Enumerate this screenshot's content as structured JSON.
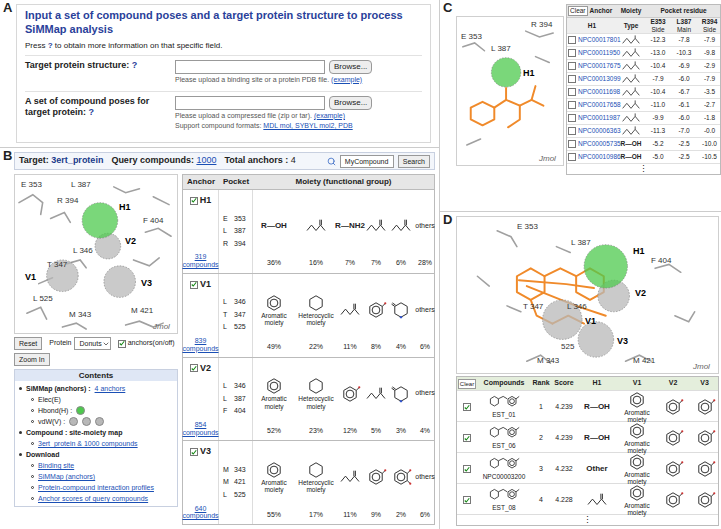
{
  "panel_letters": [
    "A",
    "B",
    "C",
    "D"
  ],
  "form": {
    "title": "Input a set of compound poses and a target protein structure to process SiMMap analysis",
    "help_prefix": "Press",
    "help_icon": "?",
    "help_suffix": "to obtain more information on that specific field.",
    "fields": [
      {
        "label": "Target protein structure:",
        "help": "?",
        "button": "Browse...",
        "hint": "Please upload a binding site or a protein PDB file.",
        "example": "(example)"
      },
      {
        "label": "A set of compound poses for target protein:",
        "help": "?",
        "button": "Browse...",
        "hint": "Please upload a compressed file (zip or tar).",
        "example": "(example)"
      }
    ],
    "formats_label": "Support compound formats:",
    "formats": "MDL mol, SYBYL mol2, PDB"
  },
  "summary": {
    "target_label": "Target:",
    "target": "3ert_protein",
    "query_label": "Query compounds:",
    "query": "1000",
    "total_label": "Total anchors :",
    "total": "4"
  },
  "search": {
    "value": "MyCompound",
    "button": "Search"
  },
  "viewer_b": {
    "residues": [
      "E 353",
      "L 387",
      "R 394",
      "F 404",
      "L 346",
      "T 347",
      "L 525",
      "M 343",
      "M 421"
    ],
    "anchors": [
      {
        "label": "H1",
        "color": "#4ec94e"
      },
      {
        "label": "V2",
        "color": "#b8b8b8"
      },
      {
        "label": "V1",
        "color": "#b8b8b8"
      },
      {
        "label": "V3",
        "color": "#b8b8b8"
      }
    ],
    "brand": "Jmol"
  },
  "controls": {
    "reset": "Reset",
    "protein_label": "Protein",
    "protein_value": "Donuts",
    "anchors_toggle": {
      "label": "anchors(on/off)",
      "checked": true
    },
    "zoom": "Zoom In"
  },
  "contents": {
    "title": "Contents",
    "items": [
      {
        "text": "SiMMap (anchors) :",
        "link": "4 anchors",
        "children": [
          {
            "text": "Elec(E)",
            "spheres": []
          },
          {
            "text": "Hbond(H) :",
            "spheres": [
              "#4ec94e"
            ]
          },
          {
            "text": "vdW(V) :",
            "spheres": [
              "#b8b8b8",
              "#b8b8b8",
              "#b8b8b8"
            ]
          }
        ]
      },
      {
        "text": "Compound : site-moiety map",
        "link": "",
        "children": [
          {
            "link": "3ert_protein & 1000 compounds"
          }
        ]
      },
      {
        "text": "Download",
        "link": "",
        "children": [
          {
            "link": "Binding site"
          },
          {
            "link": "SiMMap (anchors)"
          },
          {
            "link": "Protein-compound interaction profiles"
          },
          {
            "link": "Anchor scores of query compounds"
          }
        ]
      }
    ]
  },
  "anchor_table": {
    "columns": [
      "Anchor",
      "Pocket",
      "Moiety (functional group)"
    ],
    "rows": [
      {
        "anchor": "H1",
        "checked": true,
        "compounds": "319 compounds",
        "pocket": [
          {
            "aa": "E",
            "num": "353"
          },
          {
            "aa": "L",
            "num": "387"
          },
          {
            "aa": "R",
            "num": "394"
          }
        ],
        "moieties": [
          {
            "kind": "formula",
            "label": "R—OH",
            "pct": "36%"
          },
          {
            "kind": "chain",
            "pct": "16%"
          },
          {
            "kind": "formula",
            "label": "R—NH2",
            "pct": "7%"
          },
          {
            "kind": "chain",
            "pct": "7%"
          },
          {
            "kind": "chain",
            "pct": "6%"
          },
          {
            "kind": "others",
            "label": "others",
            "pct": "28%"
          }
        ]
      },
      {
        "anchor": "V1",
        "checked": true,
        "compounds": "839 compounds",
        "pocket": [
          {
            "aa": "L",
            "num": "346"
          },
          {
            "aa": "T",
            "num": "347"
          },
          {
            "aa": "L",
            "num": "525"
          }
        ],
        "moieties": [
          {
            "kind": "benzene",
            "label": "Aromatic moiety",
            "pct": "49%"
          },
          {
            "kind": "cyclohexane",
            "label": "Heterocyclic moiety",
            "pct": "22%"
          },
          {
            "kind": "chain",
            "pct": "11%"
          },
          {
            "kind": "phenol",
            "pct": "8%"
          },
          {
            "kind": "pyridone",
            "pct": "4%"
          },
          {
            "kind": "others",
            "label": "others",
            "pct": "6%"
          }
        ]
      },
      {
        "anchor": "V2",
        "checked": true,
        "compounds": "854 compounds",
        "pocket": [
          {
            "aa": "L",
            "num": "346"
          },
          {
            "aa": "L",
            "num": "387"
          },
          {
            "aa": "F",
            "num": "404"
          }
        ],
        "moieties": [
          {
            "kind": "benzene",
            "label": "Aromatic moiety",
            "pct": "52%"
          },
          {
            "kind": "cyclohexane",
            "label": "Heterocyclic moiety",
            "pct": "23%"
          },
          {
            "kind": "phenol",
            "pct": "12%"
          },
          {
            "kind": "chain",
            "pct": "5%"
          },
          {
            "kind": "pyridone",
            "pct": "3%"
          },
          {
            "kind": "others",
            "label": "others",
            "pct": "4%"
          }
        ]
      },
      {
        "anchor": "V3",
        "checked": true,
        "compounds": "640 compounds",
        "pocket": [
          {
            "aa": "M",
            "num": "343"
          },
          {
            "aa": "M",
            "num": "421"
          },
          {
            "aa": "L",
            "num": "525"
          }
        ],
        "moieties": [
          {
            "kind": "benzene",
            "label": "Aromatic moiety",
            "pct": "55%"
          },
          {
            "kind": "cyclohexane",
            "label": "Heterocyclic moiety",
            "pct": "17%"
          },
          {
            "kind": "chain",
            "pct": "11%"
          },
          {
            "kind": "phenol",
            "pct": "9%"
          },
          {
            "kind": "catechol",
            "pct": "2%"
          },
          {
            "kind": "others",
            "label": "others",
            "pct": "6%"
          }
        ]
      }
    ]
  },
  "viewer_c": {
    "residues": [
      "R 394",
      "E 353",
      "L 387"
    ],
    "anchors": [
      {
        "label": "H1",
        "color": "#4ec94e"
      }
    ],
    "brand": "Jmol"
  },
  "profile_table": {
    "clear": "Clear",
    "header": [
      "Anchor",
      "Moiety",
      "Pocket residue"
    ],
    "anchor": "H1",
    "type": "Type",
    "residues": [
      {
        "name": "E353",
        "part": "Side"
      },
      {
        "name": "L387",
        "part": "Main"
      },
      {
        "name": "R394",
        "part": "Side"
      }
    ],
    "rows": [
      {
        "id": "NPC00017801",
        "checked": false,
        "type": {
          "kind": "chain"
        },
        "scores": [
          "-12.3",
          "-7.8",
          "-7.9"
        ]
      },
      {
        "id": "NPC00011950",
        "checked": false,
        "type": {
          "kind": "chain"
        },
        "scores": [
          "-13.0",
          "-10.3",
          "-9.8"
        ]
      },
      {
        "id": "NPC00017675",
        "checked": false,
        "type": {
          "kind": "chain"
        },
        "scores": [
          "-10.4",
          "-6.9",
          "-2.9"
        ]
      },
      {
        "id": "NPC00013099",
        "checked": false,
        "type": {
          "kind": "chain"
        },
        "scores": [
          "-7.9",
          "-6.0",
          "-7.9"
        ]
      },
      {
        "id": "NPC00011698",
        "checked": false,
        "type": {
          "kind": "chain"
        },
        "scores": [
          "-10.4",
          "-6.7",
          "-3.5"
        ]
      },
      {
        "id": "NPC00017658",
        "checked": false,
        "type": {
          "kind": "chain"
        },
        "scores": [
          "-11.0",
          "-6.1",
          "-2.7"
        ]
      },
      {
        "id": "NPC00011987",
        "checked": false,
        "type": {
          "kind": "chain"
        },
        "scores": [
          "-9.9",
          "-6.0",
          "-1.8"
        ]
      },
      {
        "id": "NPC00006363",
        "checked": false,
        "type": {
          "kind": "chain"
        },
        "scores": [
          "-11.3",
          "-7.0",
          "-0.0"
        ]
      },
      {
        "id": "NPC00005735",
        "checked": false,
        "type": {
          "kind": "formula",
          "label": "R—OH"
        },
        "scores": [
          "-5.2",
          "-2.5",
          "-10.0"
        ]
      },
      {
        "id": "NPC00010986",
        "checked": false,
        "type": {
          "kind": "formula",
          "label": "R—OH"
        },
        "scores": [
          "-5.0",
          "-2.5",
          "-10.5"
        ]
      }
    ],
    "more": "⋮"
  },
  "viewer_d": {
    "residues": [
      "E 353",
      "L 387",
      "F 404",
      "T 347",
      "L 346",
      "M 343",
      "M 421",
      "525"
    ],
    "anchors": [
      {
        "label": "H1",
        "color": "#4ec94e"
      },
      {
        "label": "V2",
        "color": "#b8b8b8"
      },
      {
        "label": "V1",
        "color": "#b8b8b8"
      },
      {
        "label": "V3",
        "color": "#b8b8b8"
      }
    ],
    "brand": "Jmol"
  },
  "rank_table": {
    "clear": "Clear",
    "columns": [
      "Compounds",
      "Rank",
      "Score",
      "H1",
      "V1",
      "V2",
      "V3"
    ],
    "rows": [
      {
        "checked": true,
        "name": "EST_01",
        "rank": "1",
        "score": "4.239",
        "moieties": [
          {
            "kind": "formula",
            "label": "R—OH"
          },
          {
            "kind": "benzene",
            "label": "Aromatic moiety"
          },
          {
            "kind": "phenol"
          },
          {
            "kind": "phenol"
          }
        ]
      },
      {
        "checked": true,
        "name": "EST_06",
        "rank": "2",
        "score": "4.239",
        "moieties": [
          {
            "kind": "formula",
            "label": "R—OH"
          },
          {
            "kind": "benzene",
            "label": "Aromatic moiety"
          },
          {
            "kind": "phenol"
          },
          {
            "kind": "phenol"
          }
        ]
      },
      {
        "checked": true,
        "name": "NPC00003200",
        "rank": "3",
        "score": "4.232",
        "moieties": [
          {
            "kind": "formula",
            "label": "Other"
          },
          {
            "kind": "benzene",
            "label": "Aromatic moiety"
          },
          {
            "kind": "phenol"
          },
          {
            "kind": "phenol"
          }
        ]
      },
      {
        "checked": true,
        "name": "EST_08",
        "rank": "4",
        "score": "4.228",
        "moieties": [
          {
            "kind": "chain"
          },
          {
            "kind": "benzene",
            "label": "Aromatic moiety"
          },
          {
            "kind": "phenol"
          },
          {
            "kind": "phenol"
          }
        ]
      }
    ],
    "more": "⋮"
  }
}
